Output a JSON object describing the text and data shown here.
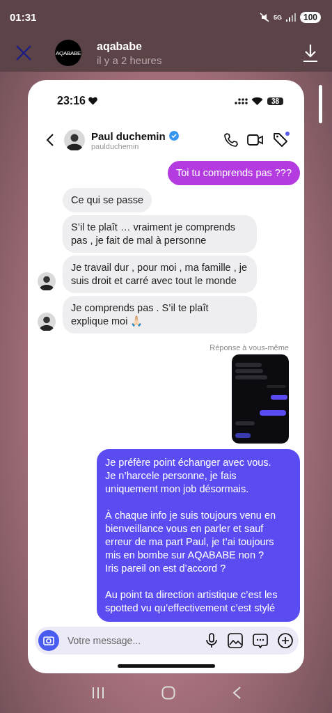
{
  "status_bar": {
    "time": "01:31",
    "network": "5G",
    "battery": "100"
  },
  "story": {
    "avatar_text": "AQABABE",
    "username": "aqababe",
    "time_ago": "il y a 2 heures"
  },
  "screenshot": {
    "status_bar": {
      "time": "23:16",
      "battery": "38"
    },
    "chat_header": {
      "name": "Paul duchemin",
      "verified": true,
      "handle": "paulduchemin",
      "tag_badge": true
    },
    "messages": [
      {
        "kind": "sent",
        "color": "#b43be0",
        "text": "Toi tu comprends pas ???"
      },
      {
        "kind": "received",
        "avatar": false,
        "text": "Ce qui se passe"
      },
      {
        "kind": "received",
        "avatar": false,
        "text": "S’il te plaît … vraiment je comprends pas , je fait de mal à personne"
      },
      {
        "kind": "received",
        "avatar": true,
        "text": "Je travail dur , pour moi , ma famille , je suis droit et carré avec tout le monde"
      },
      {
        "kind": "received",
        "avatar": true,
        "text": "Je comprends pas . S’il te plaît explique moi 🙏🏻"
      },
      {
        "kind": "reply_label",
        "text": "Réponse à vous-même"
      },
      {
        "kind": "image"
      },
      {
        "kind": "sent",
        "color": "#5a4cf0",
        "text": "Je préfère point échanger avec vous.\nJe n’harcele personne, je fais uniquement mon job désormais.\n\nÀ chaque info je suis toujours venu en bienveillance vous en parler et sauf erreur de ma part Paul, je t’ai toujours mis en bombe sur AQABABE non ?\nIris pareil on est d’accord ?\n\nAu point ta direction artistique c’est les spotted vu qu’effectivement c’est stylé"
      }
    ],
    "composer": {
      "placeholder": "Votre message..."
    }
  }
}
